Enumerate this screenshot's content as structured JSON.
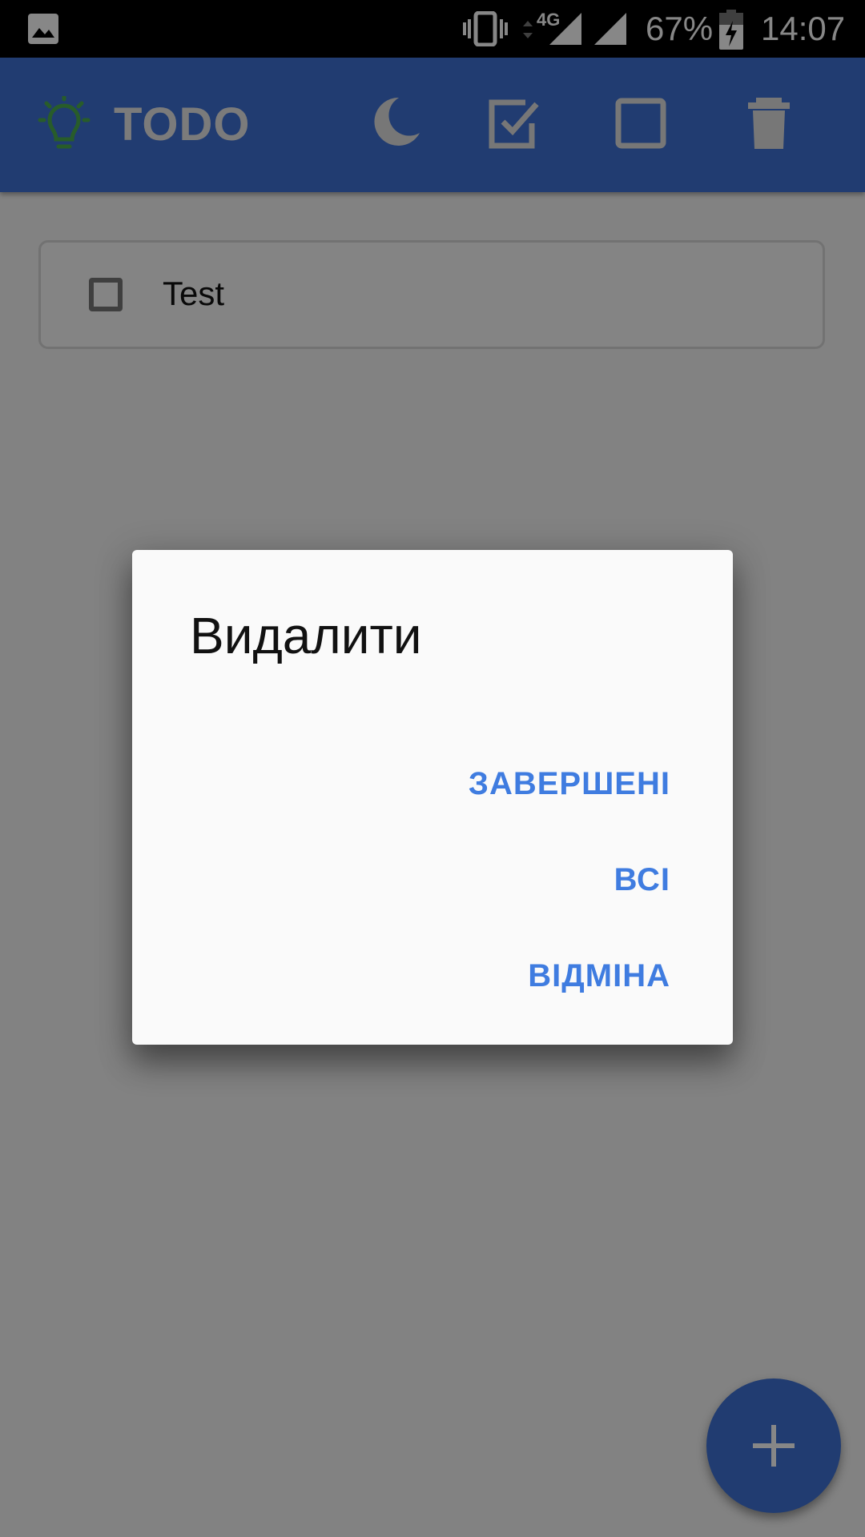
{
  "status_bar": {
    "network_type": "4G",
    "battery_percent": "67%",
    "time": "14:07"
  },
  "app_bar": {
    "title": "TODO",
    "accent_color": "#3f72d6",
    "icons": [
      "lightbulb-icon",
      "moon-icon",
      "checkbox-checked-icon",
      "checkbox-empty-icon",
      "trash-icon"
    ]
  },
  "todos": [
    {
      "text": "Test",
      "checked": false
    }
  ],
  "dialog": {
    "title": "Видалити",
    "buttons": {
      "completed": "ЗАВЕРШЕНІ",
      "all": "ВСІ",
      "cancel": "ВІДМІНА"
    },
    "button_color": "#3f7ce0"
  },
  "fab": {
    "icon": "plus-icon"
  }
}
